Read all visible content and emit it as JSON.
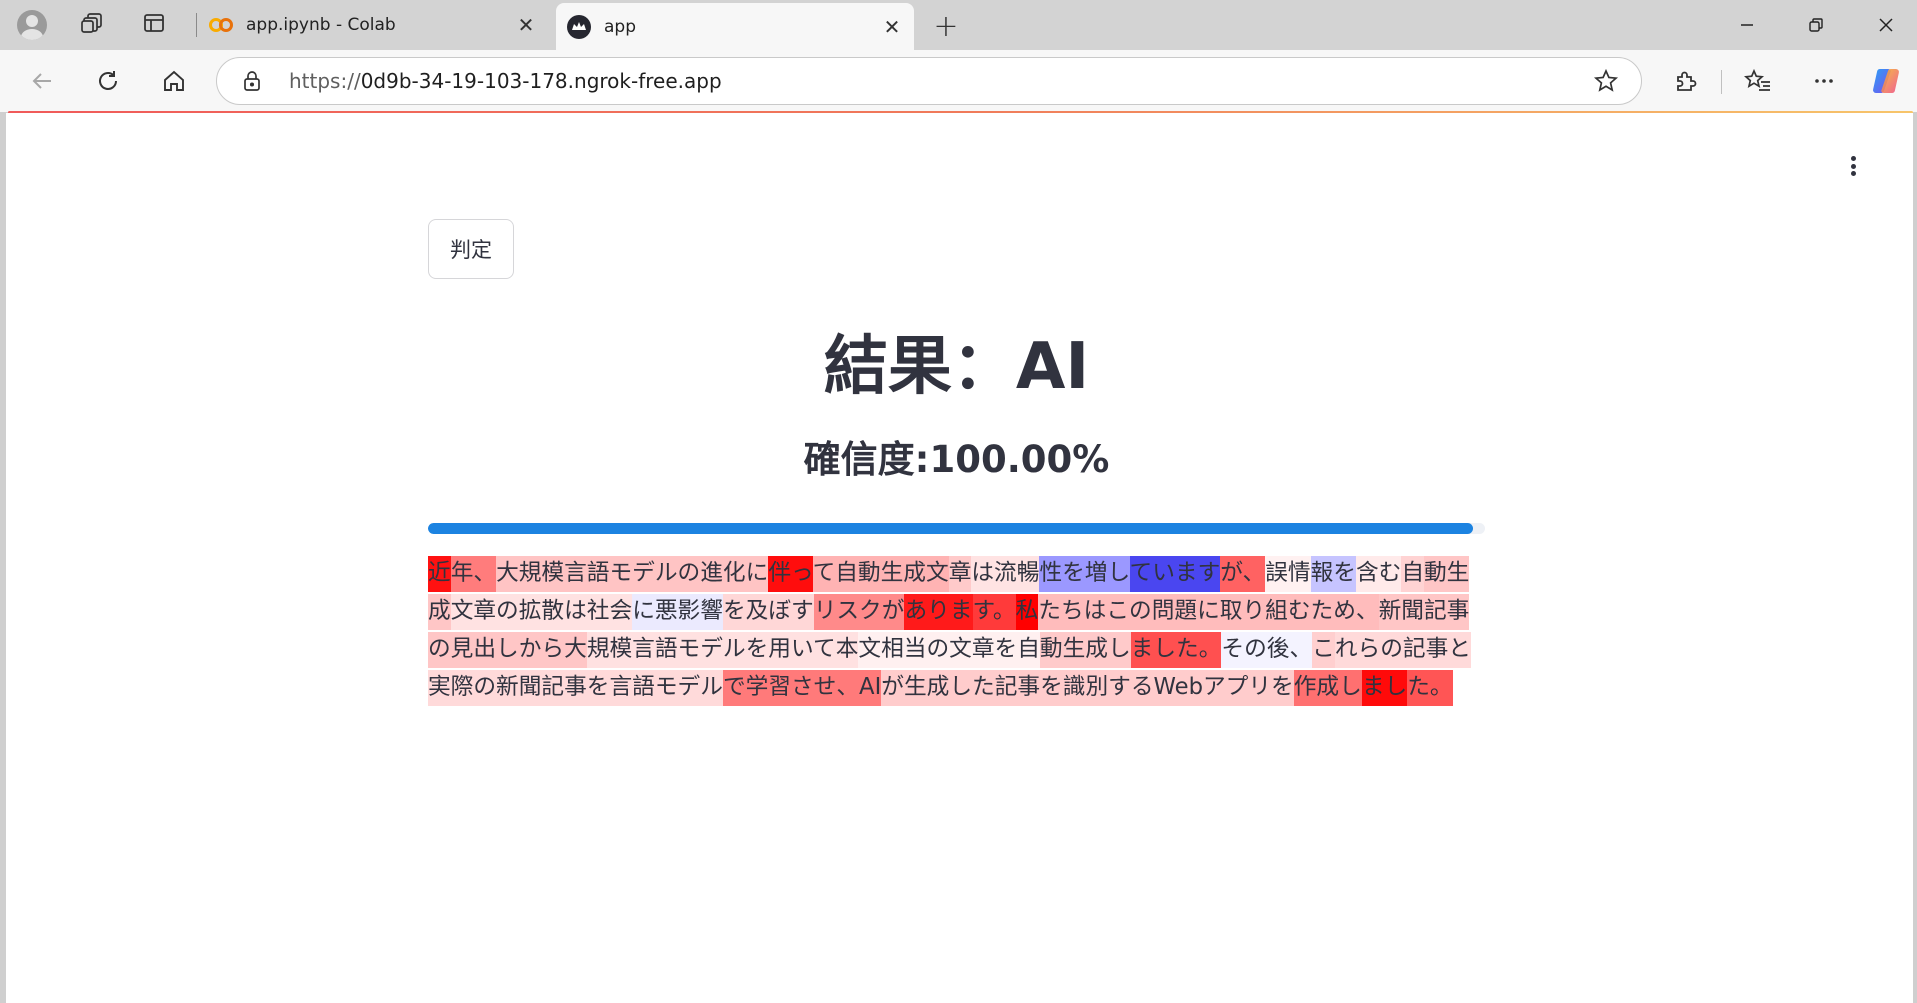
{
  "browser": {
    "tabs": [
      {
        "title": "app.ipynb - Colab",
        "favicon": "colab-icon",
        "active": false
      },
      {
        "title": "app",
        "favicon": "streamlit-icon",
        "active": true
      }
    ],
    "url_scheme": "https://",
    "url_host": "0d9b-34-19-103-178.ngrok-free.app"
  },
  "app": {
    "judge_button": "判定",
    "result_title": "結果：AI",
    "confidence_text": "確信度:100.00%",
    "confidence_value": 1.0,
    "colors": {
      "progress": "#1c83e1",
      "text": "#31333f",
      "ai_strong": "#ff0000",
      "human_strong": "#4a46f0"
    },
    "tokens": [
      {
        "t": "近",
        "c": "#ff1111"
      },
      {
        "t": "年、",
        "c": "#ff7c7c"
      },
      {
        "t": "大規模言語モデルの進化に",
        "c": "#ffc4c4"
      },
      {
        "t": "伴っ",
        "c": "#ff0d0d"
      },
      {
        "t": "て自動生成文",
        "c": "#ffb3b3"
      },
      {
        "t": "章",
        "c": "#ffcaca"
      },
      {
        "t": "は流暢",
        "c": "#ffe3e3"
      },
      {
        "t": "性を増し",
        "c": "#9b98ff"
      },
      {
        "t": "ています",
        "c": "#4a46f0"
      },
      {
        "t": "が、",
        "c": "#ff6262"
      },
      {
        "t": "誤情",
        "c": "#fff1f1"
      },
      {
        "t": "報を",
        "c": "#c6c4ff"
      },
      {
        "t": "含む",
        "c": "#ffeaea"
      },
      {
        "t": "自",
        "c": "#ffd3d3"
      },
      {
        "t": "動生成",
        "c": "#ffc6c6"
      },
      {
        "t": "文章の拡散は社会",
        "c": "#ffe2e2"
      },
      {
        "t": "に悪影響",
        "c": "#ebeafe"
      },
      {
        "t": "を及ぼす",
        "c": "#ffd7d7"
      },
      {
        "t": "リスクが",
        "c": "#ff8a8a"
      },
      {
        "t": "ありま",
        "c": "#ff1a1a"
      },
      {
        "t": "す。",
        "c": "#ff3a3a"
      },
      {
        "t": "私",
        "c": "#ff0000"
      },
      {
        "t": "たちはこの問題に取り組むため、",
        "c": "#ffbcbc"
      },
      {
        "t": "新聞記事の見出しから大",
        "c": "#ffc6c6"
      },
      {
        "t": "規模言語モデルを用いて本",
        "c": "#ffe1e1"
      },
      {
        "t": "文相当の文章を自",
        "c": "#fff0f0"
      },
      {
        "t": "動生成し",
        "c": "#ffcaca"
      },
      {
        "t": "ました。",
        "c": "#ff5050"
      },
      {
        "t": "その後、",
        "c": "#f4f3ff"
      },
      {
        "t": "こ",
        "c": "#ffcfcf"
      },
      {
        "t": "れらの記事と実際の新聞記事を言語モデル",
        "c": "#ffdada"
      },
      {
        "t": "で学習させ、AI",
        "c": "#ff7a7a"
      },
      {
        "t": "が生成した記事を識別するWebアプリを",
        "c": "#ffcccc"
      },
      {
        "t": "作成し",
        "c": "#ff7070"
      },
      {
        "t": "まし",
        "c": "#ff0a0a"
      },
      {
        "t": "た。",
        "c": "#ff5555"
      }
    ]
  }
}
